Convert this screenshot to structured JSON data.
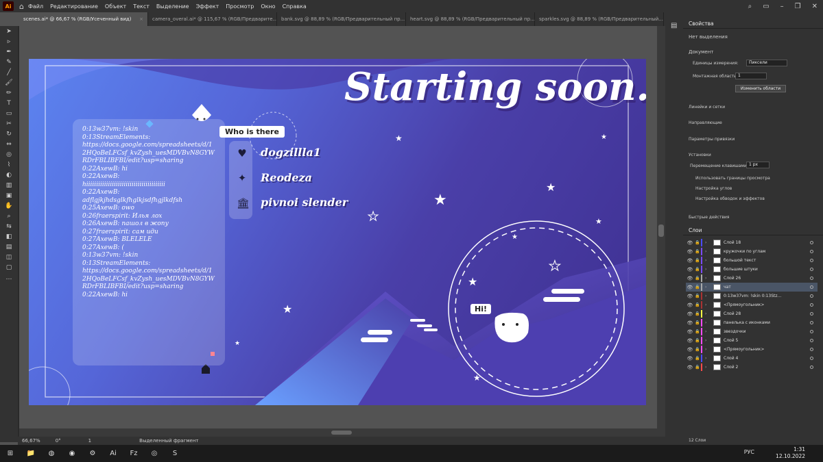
{
  "menu": {
    "app": "Ai",
    "items": [
      "Файл",
      "Редактирование",
      "Объект",
      "Текст",
      "Выделение",
      "Эффект",
      "Просмотр",
      "Окно",
      "Справка"
    ]
  },
  "tabs": [
    {
      "label": "scenes.ai* @ 66,67 % (RGB/Усеченный вид)",
      "active": true
    },
    {
      "label": "camera_overal.ai* @ 115,67 % (RGB/Предварите...",
      "active": false
    },
    {
      "label": "bank.svg @ 88,89 % (RGB/Предварительный пр...",
      "active": false
    },
    {
      "label": "heart.svg @ 88,89 % (RGB/Предварительный пр...",
      "active": false
    },
    {
      "label": "sparkles.svg @ 88,89 % (RGB/Предварительный...",
      "active": false
    }
  ],
  "artboard": {
    "title": "Starting soon.",
    "who_label": "Who is there",
    "users": [
      "dogzillla1",
      "Reodeza",
      "pivnoi slender"
    ],
    "hi": "Hi!",
    "chat": "0:13w37vm: !skin\n0:13StreamElements:\nhttps://docs.google.com/spreadsheets/d/12HQoBeLFCsf_kvZysh_uesMDVBvN8GYWRDrFBLIBFBI/edit?usp=sharing\n0:22AxewB: hi\n0:22AxewB:\nhiiiiiiiiiiiiiiiiiiiiiiiiiiiiiiiiiiiiiiii\n0:22AxewB:\nadflgjkjhdsglkfhglkjsdfhgjlkdfsh\n0:25AxewB: owo\n0:26fraerspirit: Илья лох\n0:26AxewB: пашол в жопу\n0:27fraerspirit: сам иди\n0:27AxewB: BLELELE\n0:27AxewB: (\n0:13w37vm: !skin\n0:13StreamElements:\nhttps://docs.google.com/spreadsheets/d/12HQoBeLFCsf_kvZysh_uesMDVBvN8GYWRDrFBLIBFBI/edit?usp=sharing\n0:22AxewB: hi"
  },
  "status": {
    "zoom": "66,67%",
    "angle": "0°",
    "page": "1",
    "mode": "Выделенный фрагмент"
  },
  "properties": {
    "tab": "Свойства",
    "no_selection": "Нет выделения",
    "document": "Документ",
    "units_label": "Единицы измерения:",
    "units_value": "Пиксели",
    "artboards_label": "Монтажная области:",
    "artboards_value": "1",
    "edit_artboards": "Изменить области",
    "rulers": "Линейки и сетки",
    "guides": "Направляющие",
    "snap": "Параметры привязки",
    "prefs": "Установки",
    "key_inc_label": "Перемещение клавишами:",
    "key_inc_value": "1 px",
    "cb1": "Использовать границы просмотра",
    "cb2": "Настройка углов",
    "cb3": "Настройка обводок и эффектов",
    "quick": "Быстрые действия"
  },
  "layers": {
    "tab": "Слои",
    "count": "12 Слои",
    "rows": [
      {
        "name": "Слой 18",
        "color": "#4b4bff",
        "sel": false
      },
      {
        "name": "кружочки по углам",
        "color": "#7b4bff",
        "sel": false
      },
      {
        "name": "большой текст",
        "color": "#7b4bff",
        "sel": false
      },
      {
        "name": "большие штуки",
        "color": "#7b4bff",
        "sel": false
      },
      {
        "name": "Слой 26",
        "color": "#aaaaaa",
        "sel": false
      },
      {
        "name": "чат",
        "color": "#aaaaaa",
        "sel": true
      },
      {
        "name": "0:13w37vm: !skin 0:13Stz...",
        "color": "#aa3333",
        "sel": false
      },
      {
        "name": "<Прямоугольник>",
        "color": "#aa3333",
        "sel": false
      },
      {
        "name": "Слой 28",
        "color": "#ffff44",
        "sel": false
      },
      {
        "name": "панелька с иконками",
        "color": "#ff4bff",
        "sel": false
      },
      {
        "name": "звездочки",
        "color": "#ff4bff",
        "sel": false
      },
      {
        "name": "Слой 5",
        "color": "#ff4bff",
        "sel": false
      },
      {
        "name": "<Прямоугольник>",
        "color": "#ff4bff",
        "sel": false
      },
      {
        "name": "Слой 4",
        "color": "#4b4bff",
        "sel": false
      },
      {
        "name": "Слой 2",
        "color": "#ff4b4b",
        "sel": false
      }
    ]
  },
  "taskbar": {
    "lang": "РУС",
    "time": "1:31",
    "date": "12.10.2022"
  }
}
